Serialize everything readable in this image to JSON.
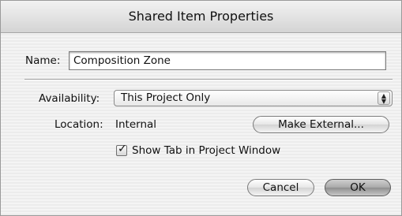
{
  "dialog": {
    "title": "Shared Item Properties"
  },
  "name_field": {
    "label": "Name:",
    "value": "Composition Zone"
  },
  "availability": {
    "label": "Availability:",
    "selected": "This Project Only"
  },
  "location": {
    "label": "Location:",
    "value": "Internal",
    "button_label": "Make External..."
  },
  "show_tab": {
    "label": "Show Tab in Project Window",
    "checked": true
  },
  "buttons": {
    "cancel": "Cancel",
    "ok": "OK"
  },
  "icons": {
    "select_arrows": "up-down-arrows-icon",
    "check": "checkmark-icon"
  }
}
